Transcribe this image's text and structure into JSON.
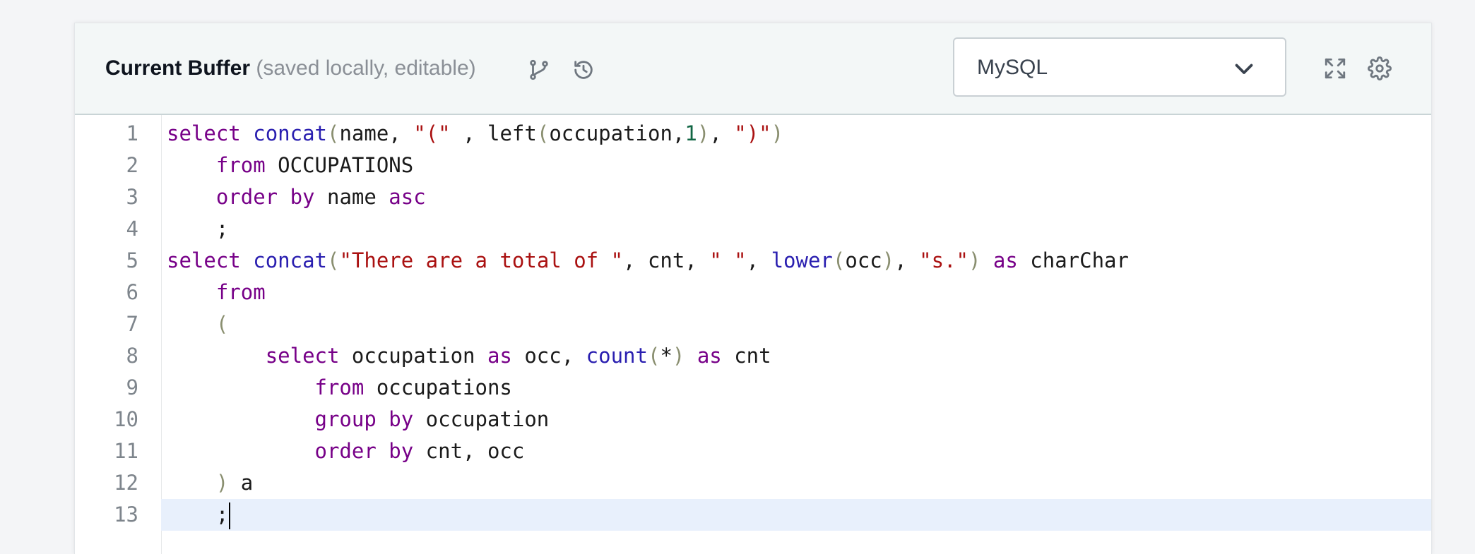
{
  "header": {
    "title": "Current Buffer",
    "subtitle": "(saved locally, editable)",
    "language": "MySQL"
  },
  "icons": {
    "branch": "git-branch-icon",
    "history": "history-icon",
    "chevron": "chevron-down-icon",
    "fullscreen": "fullscreen-icon",
    "settings": "gear-icon"
  },
  "editor": {
    "active_line": 13,
    "lines": [
      {
        "num": "1",
        "tokens": [
          [
            "kw",
            "select"
          ],
          [
            "",
            " "
          ],
          [
            "fn",
            "concat"
          ],
          [
            "br",
            "("
          ],
          [
            "",
            "name, "
          ],
          [
            "str",
            "\"(\""
          ],
          [
            "",
            " , left"
          ],
          [
            "br",
            "("
          ],
          [
            "",
            "occupation,"
          ],
          [
            "num",
            "1"
          ],
          [
            "br",
            ")"
          ],
          [
            "",
            ", "
          ],
          [
            "str",
            "\")\""
          ],
          [
            "br",
            ")"
          ]
        ]
      },
      {
        "num": "2",
        "tokens": [
          [
            "",
            "    "
          ],
          [
            "kw",
            "from"
          ],
          [
            "",
            " OCCUPATIONS"
          ]
        ]
      },
      {
        "num": "3",
        "tokens": [
          [
            "",
            "    "
          ],
          [
            "kw",
            "order by"
          ],
          [
            "",
            " name "
          ],
          [
            "kw",
            "asc"
          ]
        ]
      },
      {
        "num": "4",
        "tokens": [
          [
            "",
            "    ;"
          ]
        ]
      },
      {
        "num": "5",
        "tokens": [
          [
            "kw",
            "select"
          ],
          [
            "",
            " "
          ],
          [
            "fn",
            "concat"
          ],
          [
            "br",
            "("
          ],
          [
            "str",
            "\"There are a total of \""
          ],
          [
            "",
            ", cnt, "
          ],
          [
            "str",
            "\" \""
          ],
          [
            "",
            ", "
          ],
          [
            "fn",
            "lower"
          ],
          [
            "br",
            "("
          ],
          [
            "",
            "occ"
          ],
          [
            "br",
            ")"
          ],
          [
            "",
            ", "
          ],
          [
            "str",
            "\"s.\""
          ],
          [
            "br",
            ")"
          ],
          [
            "",
            " "
          ],
          [
            "kw",
            "as"
          ],
          [
            "",
            " charChar"
          ]
        ]
      },
      {
        "num": "6",
        "tokens": [
          [
            "",
            "    "
          ],
          [
            "kw",
            "from"
          ]
        ]
      },
      {
        "num": "7",
        "tokens": [
          [
            "",
            "    "
          ],
          [
            "br",
            "("
          ]
        ]
      },
      {
        "num": "8",
        "tokens": [
          [
            "",
            "        "
          ],
          [
            "kw",
            "select"
          ],
          [
            "",
            " occupation "
          ],
          [
            "kw",
            "as"
          ],
          [
            "",
            " occ, "
          ],
          [
            "fn",
            "count"
          ],
          [
            "br",
            "("
          ],
          [
            "",
            "*"
          ],
          [
            "br",
            ")"
          ],
          [
            "",
            " "
          ],
          [
            "kw",
            "as"
          ],
          [
            "",
            " cnt"
          ]
        ]
      },
      {
        "num": "9",
        "tokens": [
          [
            "",
            "            "
          ],
          [
            "kw",
            "from"
          ],
          [
            "",
            " occupations"
          ]
        ]
      },
      {
        "num": "10",
        "tokens": [
          [
            "",
            "            "
          ],
          [
            "kw",
            "group by"
          ],
          [
            "",
            " occupation"
          ]
        ]
      },
      {
        "num": "11",
        "tokens": [
          [
            "",
            "            "
          ],
          [
            "kw",
            "order by"
          ],
          [
            "",
            " cnt, occ"
          ]
        ]
      },
      {
        "num": "12",
        "tokens": [
          [
            "",
            "    "
          ],
          [
            "br",
            ")"
          ],
          [
            "",
            " a"
          ]
        ]
      },
      {
        "num": "13",
        "tokens": [
          [
            "",
            "    ;"
          ]
        ]
      }
    ]
  }
}
